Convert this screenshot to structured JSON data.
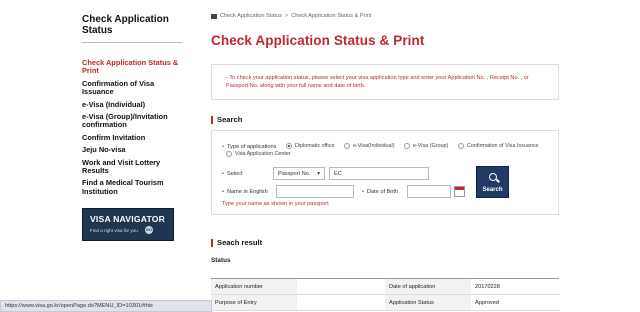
{
  "sidebar": {
    "title": "Check Application Status",
    "items": [
      {
        "label": "Check Application Status & Print"
      },
      {
        "label": "Confirmation of Visa Issuance"
      },
      {
        "label": "e-Visa (Individual)"
      },
      {
        "label": "e-Visa (Group)/Invitation confirmation"
      },
      {
        "label": "Confirm Invitation"
      },
      {
        "label": "Jeju No-visa"
      },
      {
        "label": "Work and Visit Lottery Results"
      },
      {
        "label": "Find a Medical Tourism Institution"
      }
    ],
    "banner": {
      "title": "VISA NAVIGATOR",
      "subtitle": "Find a right visa for you",
      "go": "GO"
    }
  },
  "breadcrumb": {
    "home_icon": "home-icon",
    "items": [
      "Check Application Status",
      "Check Application Status & Print"
    ],
    "separator": ">"
  },
  "main": {
    "title": "Check Application Status & Print",
    "notice": "- To check your application status, please select your visa application type and enter your Application No. , Receipt No. , or Passport No. along with your full name and date of birth."
  },
  "search": {
    "heading": "Search",
    "type_label": "Type of applications",
    "types": [
      {
        "label": "Diplomatic office",
        "selected": true
      },
      {
        "label": "e-Visa(Individual)",
        "selected": false
      },
      {
        "label": "e-Visa (Group)",
        "selected": false
      },
      {
        "label": "Confirmation of Visa Issuance",
        "selected": false
      },
      {
        "label": "Visa Application Center",
        "selected": false
      }
    ],
    "select_label": "Select",
    "select_value": "Passport No.",
    "select_input_value": "EC",
    "name_label": "Name in English",
    "name_value": "",
    "dob_label": "Date of Birth",
    "dob_value": "",
    "hint": "Type your name as shown in your passport",
    "button_label": "Search"
  },
  "result": {
    "heading": "Seach result",
    "status_label": "Status",
    "rows": [
      {
        "label1": "Application number",
        "value1": "",
        "label2": "Date of application",
        "value2": "20170228"
      },
      {
        "label1": "Purpose of Entry",
        "value1": "",
        "label2": "Application Status",
        "value2": "Approved"
      }
    ]
  },
  "statusbar": {
    "url": "https://www.visa.go.kr/openPage.do?MENU_ID=10301#this"
  },
  "colors": {
    "accent": "#c0282d",
    "button": "#213a66",
    "banner": "#1f3650"
  }
}
